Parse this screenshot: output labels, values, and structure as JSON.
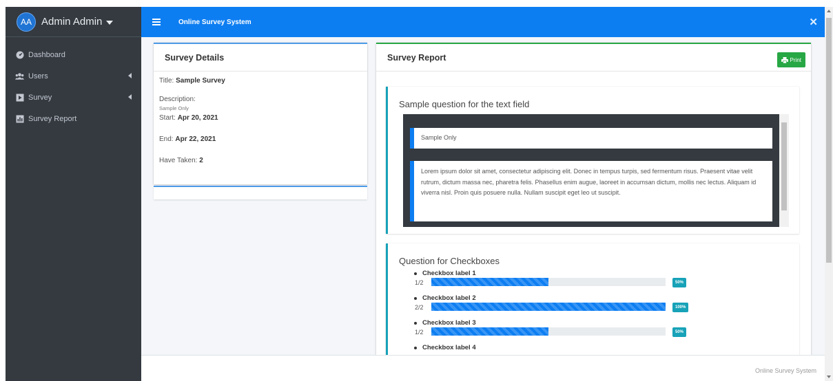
{
  "user": {
    "initials": "AA",
    "name": "Admin Admin"
  },
  "sidebar": {
    "items": [
      {
        "label": "Dashboard",
        "icon": "dashboard-icon",
        "has_children": false
      },
      {
        "label": "Users",
        "icon": "users-icon",
        "has_children": true
      },
      {
        "label": "Survey",
        "icon": "survey-icon",
        "has_children": true
      },
      {
        "label": "Survey Report",
        "icon": "report-icon",
        "has_children": false
      }
    ]
  },
  "topbar": {
    "title": "Online Survey System",
    "close_icon": "expand-close-icon"
  },
  "details": {
    "header": "Survey Details",
    "title_label": "Title:",
    "title_value": "Sample Survey",
    "desc_label": "Description:",
    "desc_value": "Sample Only",
    "start_label": "Start:",
    "start_value": "Apr 20, 2021",
    "end_label": "End:",
    "end_value": "Apr 22, 2021",
    "taken_label": "Have Taken:",
    "taken_value": "2"
  },
  "report": {
    "header": "Survey Report",
    "print_label": "Print",
    "questions": [
      {
        "title": "Sample question for the text field",
        "answers": [
          "Sample Only",
          "Lorem ipsum dolor sit amet, consectetur adipiscing elit. Donec in tempus turpis, sed fermentum risus. Praesent vitae velit rutrum, dictum massa nec, pharetra felis. Phasellus enim augue, laoreet in accumsan dictum, mollis nec lectus. Aliquam id viverra nisl. Proin quis posuere nulla. Nullam suscipit eget leo ut suscipit."
        ]
      },
      {
        "title": "Question for Checkboxes",
        "options": [
          {
            "label": "Checkbox label 1",
            "fraction": "1/2",
            "percent": 50,
            "badge": "50%"
          },
          {
            "label": "Checkbox label 2",
            "fraction": "2/2",
            "percent": 100,
            "badge": "100%"
          },
          {
            "label": "Checkbox label 3",
            "fraction": "1/2",
            "percent": 50,
            "badge": "50%"
          },
          {
            "label": "Checkbox label 4",
            "fraction": "",
            "percent": 0,
            "badge": ""
          }
        ]
      }
    ]
  },
  "footer": {
    "text": "Online Survey System"
  },
  "colors": {
    "primary": "#0d7ef2",
    "sidebar": "#343a40",
    "success": "#28a745",
    "info": "#17a2b8"
  }
}
